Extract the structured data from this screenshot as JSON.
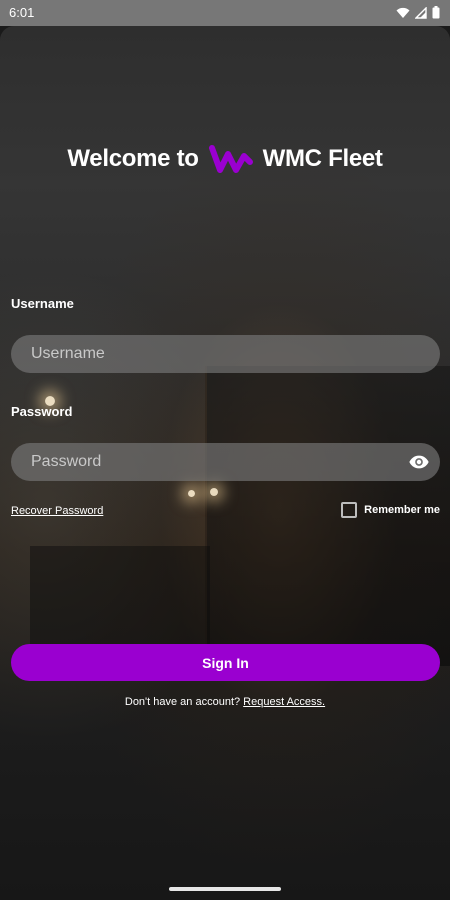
{
  "status_bar": {
    "time": "6:01"
  },
  "app": {
    "welcome_prefix": "Welcome to",
    "brand_name": "WMC Fleet",
    "brand_color": "#9a00d0"
  },
  "form": {
    "username_label": "Username",
    "username_placeholder": "Username",
    "username_value": "",
    "password_label": "Password",
    "password_placeholder": "Password",
    "password_value": "",
    "recover_label": "Recover Password",
    "remember_label": "Remember me",
    "remember_checked": false,
    "sign_in_label": "Sign In"
  },
  "footer": {
    "prompt": "Don't have an account? ",
    "request_label": "Request Access."
  },
  "icons": {
    "status": [
      "wifi-icon",
      "cellular-signal-icon",
      "battery-icon"
    ],
    "password_toggle": "eye-icon",
    "logo": "wmc-logo-icon"
  }
}
